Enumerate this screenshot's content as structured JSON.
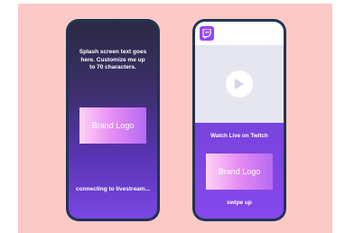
{
  "left_phone": {
    "splash_text": "Splash screen text goes here. Customize me up to 70 characters.",
    "logo_label": "Brand Logo",
    "status_text": "connecting to livestream..."
  },
  "right_phone": {
    "platform_icon": "twitch-icon",
    "video_control": "play-icon",
    "watch_label": "Watch Live on Twitch",
    "logo_label": "Brand Logo",
    "swipe_label": "swipe up"
  },
  "colors": {
    "background": "#fcc9c6",
    "phone_frame": "#1f3552",
    "accent_purple": "#9146ff"
  }
}
